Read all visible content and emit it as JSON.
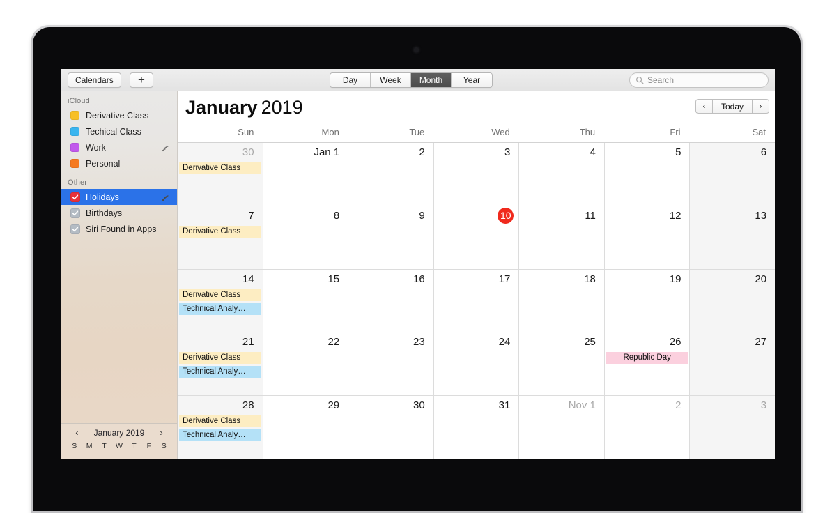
{
  "toolbar": {
    "calendars_label": "Calendars",
    "add_label": "+",
    "views": [
      {
        "label": "Day",
        "selected": false
      },
      {
        "label": "Week",
        "selected": false
      },
      {
        "label": "Month",
        "selected": true
      },
      {
        "label": "Year",
        "selected": false
      }
    ],
    "search_placeholder": "Search",
    "search_value": ""
  },
  "sidebar": {
    "icloud_header": "iCloud",
    "icloud_calendars": [
      {
        "label": "Derivative Class",
        "color": "#f7bf26"
      },
      {
        "label": "Techical Class",
        "color": "#3ab5ef"
      },
      {
        "label": "Work",
        "color": "#c159ec",
        "broadcast": true
      },
      {
        "label": "Personal",
        "color": "#f5791f"
      }
    ],
    "other_header": "Other",
    "other_calendars": [
      {
        "label": "Holidays",
        "checked": true,
        "selected": true,
        "broadcast": true
      },
      {
        "label": "Birthdays",
        "checked": true,
        "selected": false,
        "broadcast": false
      },
      {
        "label": "Siri Found in Apps",
        "checked": true,
        "selected": false,
        "broadcast": false
      }
    ],
    "mini_calendar": {
      "prev": "‹",
      "title": "January 2019",
      "next": "›",
      "day_initials": [
        "S",
        "M",
        "T",
        "W",
        "T",
        "F",
        "S"
      ]
    }
  },
  "calendar": {
    "month": "January",
    "year": "2019",
    "prev_label": "‹",
    "today_label": "Today",
    "next_label": "›",
    "day_headers": [
      "Sun",
      "Mon",
      "Tue",
      "Wed",
      "Thu",
      "Fri",
      "Sat"
    ],
    "weeks": [
      [
        {
          "num": "30",
          "other": true,
          "weekend": true,
          "today": false,
          "events": [
            {
              "title": "Derivative Class",
              "color": "yellow"
            }
          ]
        },
        {
          "num": "Jan 1",
          "other": false,
          "weekend": false,
          "today": false,
          "events": []
        },
        {
          "num": "2",
          "other": false,
          "weekend": false,
          "today": false,
          "events": []
        },
        {
          "num": "3",
          "other": false,
          "weekend": false,
          "today": false,
          "events": []
        },
        {
          "num": "4",
          "other": false,
          "weekend": false,
          "today": false,
          "events": []
        },
        {
          "num": "5",
          "other": false,
          "weekend": false,
          "today": false,
          "events": []
        },
        {
          "num": "6",
          "other": false,
          "weekend": true,
          "today": false,
          "events": []
        }
      ],
      [
        {
          "num": "7",
          "other": false,
          "weekend": true,
          "today": false,
          "events": [
            {
              "title": "Derivative Class",
              "color": "yellow"
            }
          ]
        },
        {
          "num": "8",
          "other": false,
          "weekend": false,
          "today": false,
          "events": []
        },
        {
          "num": "9",
          "other": false,
          "weekend": false,
          "today": false,
          "events": []
        },
        {
          "num": "10",
          "other": false,
          "weekend": false,
          "today": true,
          "events": []
        },
        {
          "num": "11",
          "other": false,
          "weekend": false,
          "today": false,
          "events": []
        },
        {
          "num": "12",
          "other": false,
          "weekend": false,
          "today": false,
          "events": []
        },
        {
          "num": "13",
          "other": false,
          "weekend": true,
          "today": false,
          "events": []
        }
      ],
      [
        {
          "num": "14",
          "other": false,
          "weekend": true,
          "today": false,
          "events": [
            {
              "title": "Derivative Class",
              "color": "yellow"
            },
            {
              "title": "Technical Analy…",
              "color": "blue"
            }
          ]
        },
        {
          "num": "15",
          "other": false,
          "weekend": false,
          "today": false,
          "events": []
        },
        {
          "num": "16",
          "other": false,
          "weekend": false,
          "today": false,
          "events": []
        },
        {
          "num": "17",
          "other": false,
          "weekend": false,
          "today": false,
          "events": []
        },
        {
          "num": "18",
          "other": false,
          "weekend": false,
          "today": false,
          "events": []
        },
        {
          "num": "19",
          "other": false,
          "weekend": false,
          "today": false,
          "events": []
        },
        {
          "num": "20",
          "other": false,
          "weekend": true,
          "today": false,
          "events": []
        }
      ],
      [
        {
          "num": "21",
          "other": false,
          "weekend": true,
          "today": false,
          "events": [
            {
              "title": "Derivative Class",
              "color": "yellow"
            },
            {
              "title": "Technical Analy…",
              "color": "blue"
            }
          ]
        },
        {
          "num": "22",
          "other": false,
          "weekend": false,
          "today": false,
          "events": []
        },
        {
          "num": "23",
          "other": false,
          "weekend": false,
          "today": false,
          "events": []
        },
        {
          "num": "24",
          "other": false,
          "weekend": false,
          "today": false,
          "events": []
        },
        {
          "num": "25",
          "other": false,
          "weekend": false,
          "today": false,
          "events": []
        },
        {
          "num": "26",
          "other": false,
          "weekend": false,
          "today": false,
          "events": [
            {
              "title": "Republic Day",
              "color": "pink"
            }
          ]
        },
        {
          "num": "27",
          "other": false,
          "weekend": true,
          "today": false,
          "events": []
        }
      ],
      [
        {
          "num": "28",
          "other": false,
          "weekend": true,
          "today": false,
          "events": [
            {
              "title": "Derivative Class",
              "color": "yellow"
            },
            {
              "title": "Technical Analy…",
              "color": "blue"
            }
          ]
        },
        {
          "num": "29",
          "other": false,
          "weekend": false,
          "today": false,
          "events": []
        },
        {
          "num": "30",
          "other": false,
          "weekend": false,
          "today": false,
          "events": []
        },
        {
          "num": "31",
          "other": false,
          "weekend": false,
          "today": false,
          "events": []
        },
        {
          "num": "Nov 1",
          "other": true,
          "weekend": false,
          "today": false,
          "events": []
        },
        {
          "num": "2",
          "other": true,
          "weekend": false,
          "today": false,
          "events": []
        },
        {
          "num": "3",
          "other": true,
          "weekend": true,
          "today": false,
          "events": []
        }
      ]
    ]
  }
}
